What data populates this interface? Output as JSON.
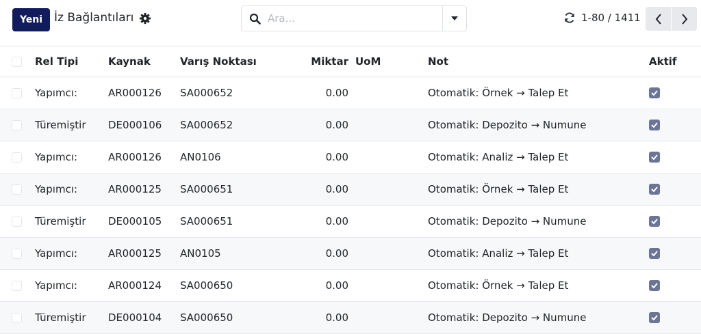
{
  "toolbar": {
    "new_label": "Yeni",
    "title": "İz Bağlantıları",
    "search_placeholder": "Ara...",
    "pager_value": "1-80 / 1411"
  },
  "table": {
    "columns": [
      "Rel Tipi",
      "Kaynak",
      "Varış Noktası",
      "Miktar",
      "UoM",
      "Not",
      "Aktif"
    ],
    "rows": [
      {
        "rel": "Yapımcı:",
        "src": "AR000126",
        "dst": "SA000652",
        "qty": "0.00",
        "uom": "",
        "note": "Otomatik: Örnek → Talep Et",
        "active": true
      },
      {
        "rel": "Türemiştir",
        "src": "DE000106",
        "dst": "SA000652",
        "qty": "0.00",
        "uom": "",
        "note": "Otomatik: Depozito → Numune",
        "active": true
      },
      {
        "rel": "Yapımcı:",
        "src": "AR000126",
        "dst": "AN0106",
        "qty": "0.00",
        "uom": "",
        "note": "Otomatik: Analiz → Talep Et",
        "active": true
      },
      {
        "rel": "Yapımcı:",
        "src": "AR000125",
        "dst": "SA000651",
        "qty": "0.00",
        "uom": "",
        "note": "Otomatik: Örnek → Talep Et",
        "active": true
      },
      {
        "rel": "Türemiştir",
        "src": "DE000105",
        "dst": "SA000651",
        "qty": "0.00",
        "uom": "",
        "note": "Otomatik: Depozito → Numune",
        "active": true
      },
      {
        "rel": "Yapımcı:",
        "src": "AR000125",
        "dst": "AN0105",
        "qty": "0.00",
        "uom": "",
        "note": "Otomatik: Analiz → Talep Et",
        "active": true
      },
      {
        "rel": "Yapımcı:",
        "src": "AR000124",
        "dst": "SA000650",
        "qty": "0.00",
        "uom": "",
        "note": "Otomatik: Örnek → Talep Et",
        "active": true
      },
      {
        "rel": "Türemiştir",
        "src": "DE000104",
        "dst": "SA000650",
        "qty": "0.00",
        "uom": "",
        "note": "Otomatik: Depozito → Numune",
        "active": true
      }
    ]
  },
  "colors": {
    "primary": "#111c5c",
    "checkbox_checked": "#6d7596",
    "row_alt": "#f7f8f9"
  }
}
